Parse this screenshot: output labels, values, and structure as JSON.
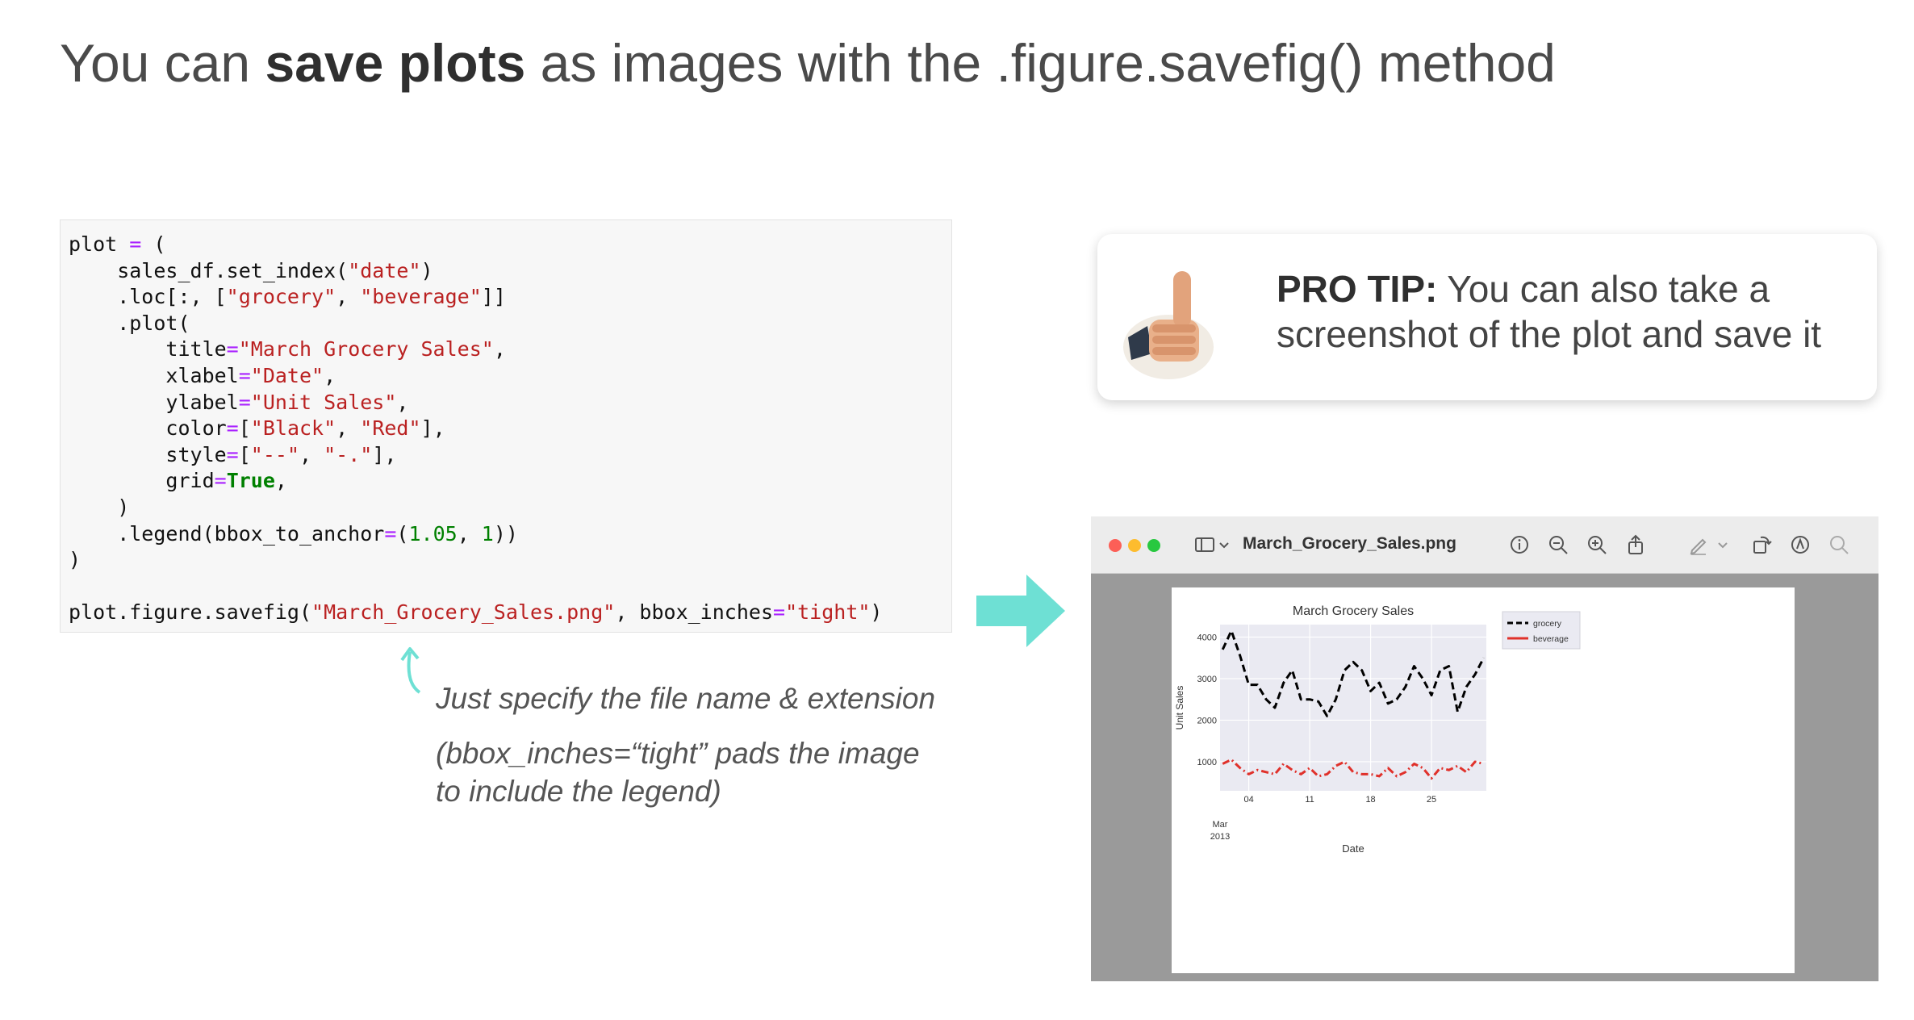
{
  "slide": {
    "title_prefix": "You can ",
    "title_bold": "save plots",
    "title_suffix": " as images with the .figure.savefig() method"
  },
  "annotation": {
    "line1": "Just specify the file name & extension",
    "line2": "(bbox_inches=“tight” pads the image",
    "line3": "to include the legend)"
  },
  "protip": {
    "label": "PRO TIP:",
    "line1": " You can also take a",
    "line2": "screenshot of the plot and save it"
  },
  "preview": {
    "file_name": "March_Grocery_Sales.png"
  },
  "colors": {
    "accent_arrow": "#6ee0d4",
    "grocery": "#000000",
    "beverage": "#e0312b"
  },
  "chart_data": {
    "type": "line",
    "title": "March Grocery Sales",
    "xlabel": "Date",
    "ylabel": "Unit Sales",
    "x": [
      1,
      2,
      3,
      4,
      5,
      6,
      7,
      8,
      9,
      10,
      11,
      12,
      13,
      14,
      15,
      16,
      17,
      18,
      19,
      20,
      21,
      22,
      23,
      24,
      25,
      26,
      27,
      28,
      29,
      30,
      31
    ],
    "x_ticks": [
      {
        "day": 4,
        "label": "04"
      },
      {
        "day": 11,
        "label": "11"
      },
      {
        "day": 18,
        "label": "18"
      },
      {
        "day": 25,
        "label": "25"
      }
    ],
    "x_sublabel_month": "Mar",
    "x_sublabel_year": "2013",
    "ylim": [
      300,
      4300
    ],
    "y_ticks": [
      1000,
      2000,
      3000,
      4000
    ],
    "grid": true,
    "legend_position": "outside-right",
    "series": [
      {
        "name": "grocery",
        "color": "#000000",
        "style": "dashed",
        "values": [
          3700,
          4150,
          3550,
          2850,
          2850,
          2500,
          2300,
          2900,
          3200,
          2500,
          2500,
          2450,
          2100,
          2500,
          3200,
          3400,
          3200,
          2700,
          2900,
          2400,
          2500,
          2800,
          3300,
          3000,
          2600,
          3200,
          3300,
          2200,
          2800,
          3100,
          3500
        ]
      },
      {
        "name": "beverage",
        "color": "#e0312b",
        "style": "dashdot",
        "values": [
          950,
          1050,
          850,
          700,
          800,
          750,
          700,
          950,
          800,
          700,
          850,
          650,
          700,
          900,
          1000,
          750,
          700,
          700,
          650,
          850,
          650,
          750,
          950,
          850,
          600,
          850,
          800,
          900,
          750,
          1000,
          950
        ]
      }
    ]
  }
}
